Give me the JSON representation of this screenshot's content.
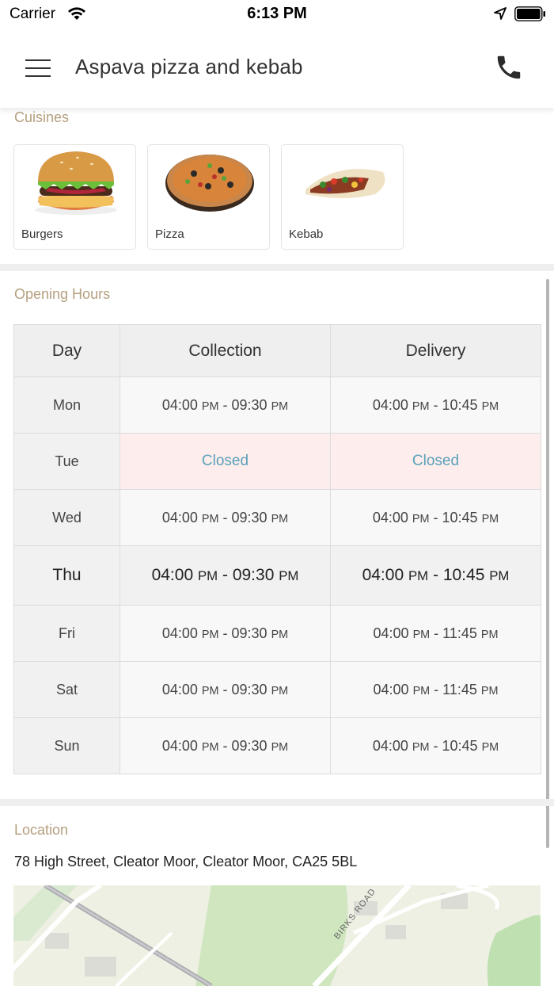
{
  "status_bar": {
    "carrier": "Carrier",
    "time": "6:13 PM"
  },
  "header": {
    "title": "Aspava pizza and kebab",
    "menu_icon": "hamburger-menu-icon",
    "phone_icon": "phone-icon"
  },
  "cuisines": {
    "label": "Cuisines",
    "items": [
      {
        "name": "Burgers"
      },
      {
        "name": "Pizza"
      },
      {
        "name": "Kebab"
      }
    ]
  },
  "opening_hours": {
    "label": "Opening Hours",
    "columns": [
      "Day",
      "Collection",
      "Delivery"
    ],
    "closed_text": "Closed",
    "rows": [
      {
        "day": "Mon",
        "c_from": "04:00",
        "c_to": "09:30",
        "d_from": "04:00",
        "d_to": "10:45",
        "ampm": "PM"
      },
      {
        "day": "Tue"
      },
      {
        "day": "Wed",
        "c_from": "04:00",
        "c_to": "09:30",
        "d_from": "04:00",
        "d_to": "10:45",
        "ampm": "PM"
      },
      {
        "day": "Thu",
        "c_from": "04:00",
        "c_to": "09:30",
        "d_from": "04:00",
        "d_to": "10:45",
        "ampm": "PM"
      },
      {
        "day": "Fri",
        "c_from": "04:00",
        "c_to": "09:30",
        "d_from": "04:00",
        "d_to": "11:45",
        "ampm": "PM"
      },
      {
        "day": "Sat",
        "c_from": "04:00",
        "c_to": "09:30",
        "d_from": "04:00",
        "d_to": "11:45",
        "ampm": "PM"
      },
      {
        "day": "Sun",
        "c_from": "04:00",
        "c_to": "09:30",
        "d_from": "04:00",
        "d_to": "10:45",
        "ampm": "PM"
      }
    ]
  },
  "location": {
    "label": "Location",
    "address": "78 High Street, Cleator Moor, Cleator Moor, CA25 5BL",
    "map_label": "BIRKS ROAD"
  },
  "colors": {
    "accent_label": "#b59f7e",
    "closed_bg": "#fdeded",
    "closed_text": "#5aa1b9"
  }
}
